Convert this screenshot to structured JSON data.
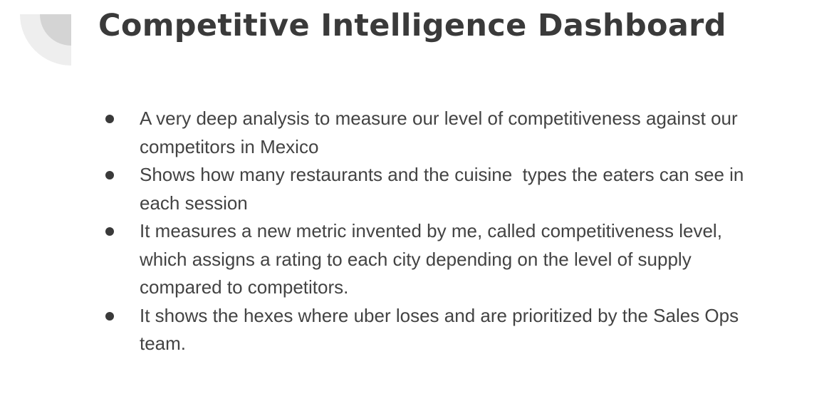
{
  "slide": {
    "title": "Competitive Intelligence Dashboard",
    "bullets": [
      {
        "text": "A very deep analysis to measure our level of competitiveness against our competitors in Mexico"
      },
      {
        "text": "Shows how many restaurants and the cuisine  types the eaters can see in each session"
      },
      {
        "text": "It measures a new metric invented by me, called competitiveness level, which assigns a rating to each city depending on the level of supply compared to competitors."
      },
      {
        "text": "It shows the hexes where uber loses and are prioritized by the Sales Ops team."
      }
    ]
  },
  "colors": {
    "title": "#3a3a3a",
    "body_text": "#434343",
    "decoration_outer": "#eeeeee",
    "decoration_inner": "#d4d4d4"
  }
}
